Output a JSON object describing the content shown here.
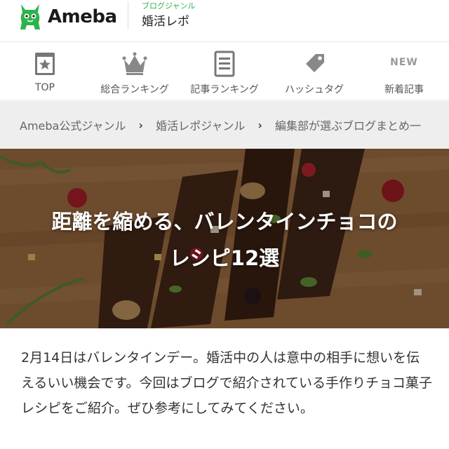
{
  "header": {
    "logo_text": "Ameba",
    "genre_sub": "ブログジャンル",
    "genre_title": "婚活レポ",
    "brand_color": "#2cb44c"
  },
  "nav": {
    "items": [
      {
        "label": "TOP",
        "icon": "star-page-icon"
      },
      {
        "label": "総合ランキング",
        "icon": "crown-icon"
      },
      {
        "label": "記事ランキング",
        "icon": "document-list-icon"
      },
      {
        "label": "ハッシュタグ",
        "icon": "tag-icon"
      },
      {
        "label": "新着記事",
        "icon": "new-text-icon",
        "badge": "NEW"
      }
    ]
  },
  "breadcrumb": {
    "items": [
      "Ameba公式ジャンル",
      "婚活レポジャンル",
      "編集部が選ぶブログまとめ一"
    ]
  },
  "hero": {
    "title_line1": "距離を縮める、バレンタインチョコの",
    "title_line2": "レシピ12選"
  },
  "article": {
    "intro": "2月14日はバレンタインデー。婚活中の人は意中の相手に想いを伝えるいい機会です。今回はブログで紹介されている手作りチョコ菓子レシピをご紹介。ぜひ参考にしてみてください。"
  }
}
